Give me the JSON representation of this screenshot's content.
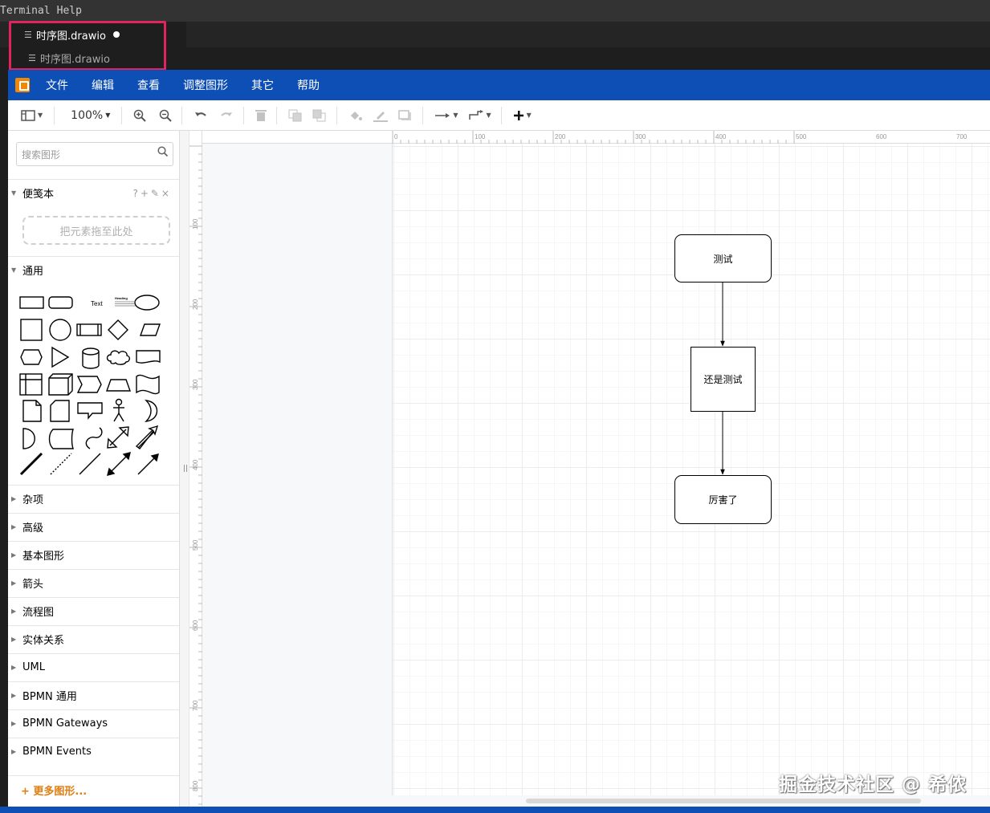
{
  "vscode": {
    "menu": [
      "Terminal",
      "Help"
    ],
    "tab_title": "时序图.drawio",
    "breadcrumb": "时序图.drawio"
  },
  "drawio": {
    "menu": [
      "文件",
      "编辑",
      "查看",
      "调整图形",
      "其它",
      "帮助"
    ],
    "toolbar": {
      "zoom": "100%"
    },
    "sidebar": {
      "search_placeholder": "搜索图形",
      "scratchpad": {
        "title": "便笺本",
        "tools": "?+✎×",
        "dropzone": "把元素拖至此处"
      },
      "general": {
        "title": "通用",
        "text_shape": "Text",
        "heading_shape": "Heading"
      },
      "collapsed_sections": [
        "杂项",
        "高级",
        "基本图形",
        "箭头",
        "流程图",
        "实体关系",
        "UML",
        "BPMN 通用",
        "BPMN Gateways",
        "BPMN Events"
      ],
      "more_shapes": "+ 更多图形..."
    },
    "ruler": {
      "horizontal": [
        "0",
        "100",
        "200",
        "300",
        "400",
        "500",
        "600",
        "700"
      ],
      "vertical": [
        "100",
        "200",
        "300",
        "400",
        "500",
        "600",
        "700",
        "800"
      ]
    },
    "diagram": {
      "nodes": [
        "测试",
        "还是测试",
        "厉害了"
      ]
    }
  },
  "watermark": "掘金技术社区 @ 希侬"
}
